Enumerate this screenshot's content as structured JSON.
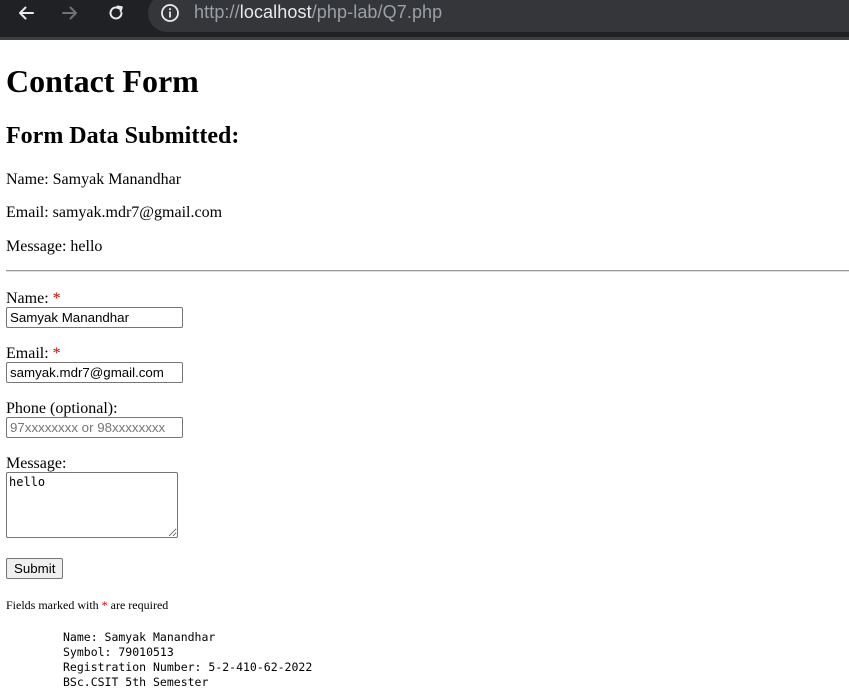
{
  "browser": {
    "url_scheme": "http://",
    "url_host": "localhost",
    "url_path": "/php-lab/Q7.php"
  },
  "page": {
    "title": "Contact Form",
    "submitted_heading": "Form Data Submitted:",
    "submitted": {
      "name": "Name: Samyak Manandhar",
      "email": "Email: samyak.mdr7@gmail.com",
      "message": "Message: hello"
    }
  },
  "form": {
    "name_label": "Name:",
    "name_value": "Samyak Manandhar",
    "email_label": "Email:",
    "email_value": "samyak.mdr7@gmail.com",
    "phone_label": "Phone (optional):",
    "phone_placeholder": "97xxxxxxxx or 98xxxxxxxx",
    "message_label": "Message:",
    "message_value": "hello",
    "submit_label": "Submit",
    "required_marker": "*",
    "note_before": "Fields marked with",
    "note_after": "are required"
  },
  "student": {
    "name_line": "Name: Samyak Manandhar",
    "symbol_line": "Symbol: 79010513",
    "reg_line": "Registration Number: 5-2-410-62-2022",
    "program_line": "BSc.CSIT 5th Semester"
  },
  "icons": {
    "back": "arrow-left-icon",
    "forward": "arrow-right-icon",
    "reload": "reload-icon",
    "site_info": "info-circle-icon"
  },
  "colors": {
    "chrome_bg": "#202124",
    "required": "#d40000"
  }
}
